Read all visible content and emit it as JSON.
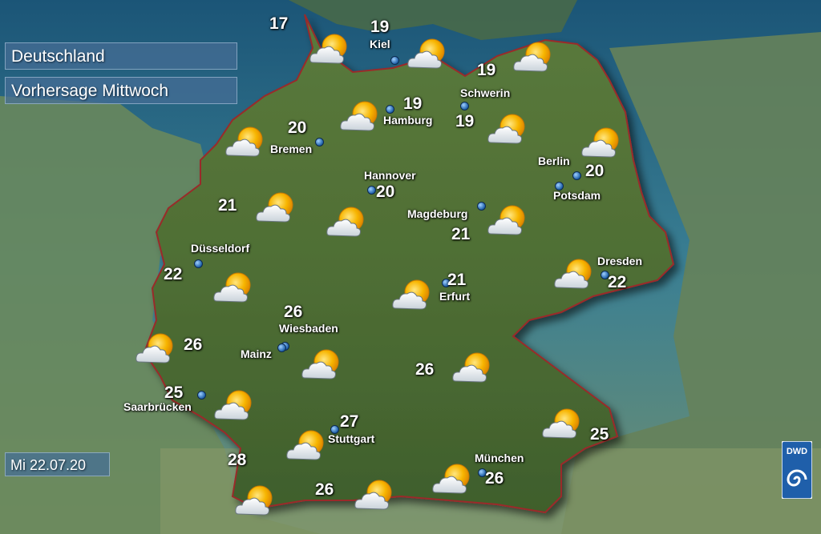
{
  "header": {
    "country": "Deutschland",
    "forecast": "Vorhersage Mittwoch"
  },
  "date_label": "Mi 22.07.20",
  "logo": {
    "text": "DWD",
    "icon": "dwd-swirl-icon",
    "color": "#1f5faa"
  },
  "icons": {
    "weather": "sun-behind-cloud-icon",
    "city_marker": "city-dot-icon"
  },
  "colors": {
    "sea": "#2f6f8f",
    "land": "#4a6a30",
    "border": "#9a2a2a",
    "sun": "#f5a800"
  },
  "cities": [
    "Kiel",
    "Hamburg",
    "Schwerin",
    "Bremen",
    "Hannover",
    "Berlin",
    "Potsdam",
    "Magdeburg",
    "Düsseldorf",
    "Dresden",
    "Erfurt",
    "Wiesbaden",
    "Mainz",
    "Saarbrücken",
    "Stuttgart",
    "München"
  ],
  "temperatures": [
    "17",
    "19",
    "19",
    "19",
    "19",
    "20",
    "20",
    "20",
    "21",
    "21",
    "21",
    "22",
    "22",
    "26",
    "26",
    "26",
    "25",
    "27",
    "28",
    "26",
    "26",
    "25"
  ]
}
